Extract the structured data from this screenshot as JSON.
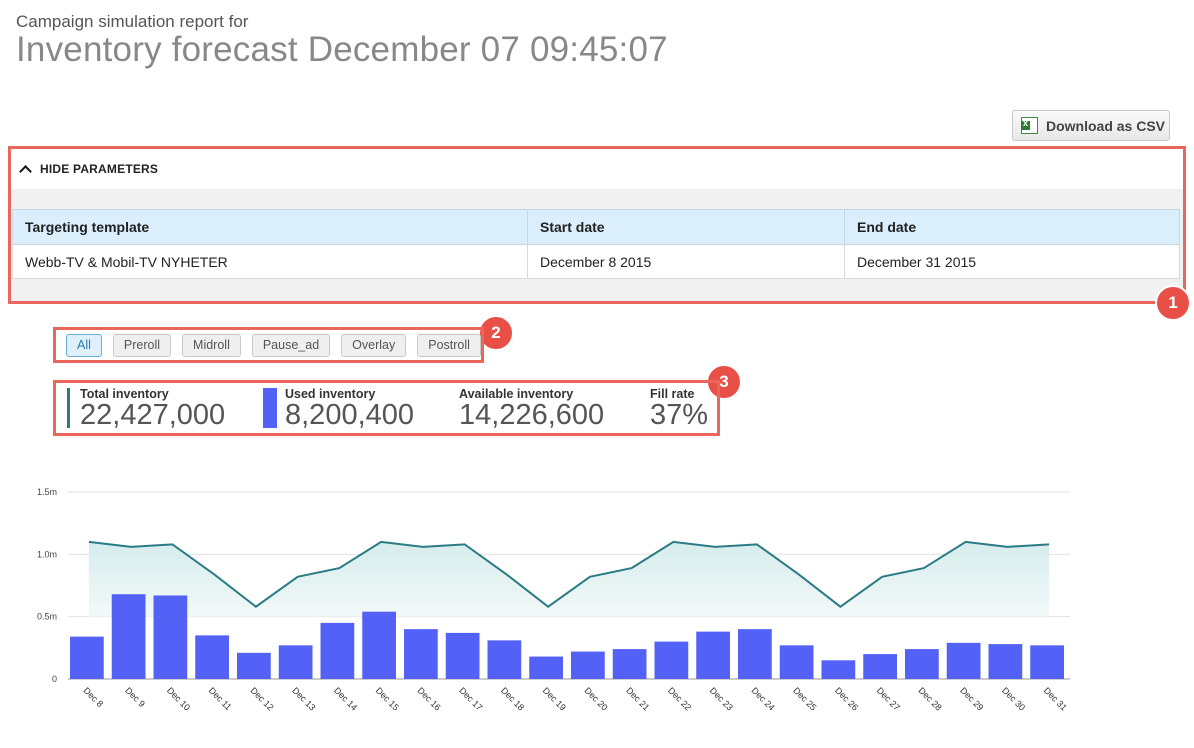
{
  "header": {
    "subtitle": "Campaign simulation report for",
    "title": "Inventory forecast December 07 09:45:07"
  },
  "toolbar": {
    "download_label": "Download as CSV",
    "download_icon": "excel-file-icon"
  },
  "parameters": {
    "toggle_label": "HIDE PARAMETERS",
    "columns": [
      "Targeting template",
      "Start date",
      "End date"
    ],
    "row": [
      "Webb-TV & Mobil-TV NYHETER",
      "December 8 2015",
      "December 31 2015"
    ]
  },
  "annotations": [
    "1",
    "2",
    "3"
  ],
  "filters": {
    "options": [
      "All",
      "Preroll",
      "Midroll",
      "Pause_ad",
      "Overlay",
      "Postroll"
    ],
    "selected": "All"
  },
  "stats": {
    "total_label": "Total inventory",
    "total_value": "22,427,000",
    "used_label": "Used inventory",
    "used_value": "8,200,400",
    "available_label": "Available inventory",
    "available_value": "14,226,600",
    "fill_label": "Fill rate",
    "fill_value": "37%"
  },
  "colors": {
    "accent_border": "#e8665a",
    "badge": "#e84f47",
    "bar": "#5461f7",
    "line": "#2a7b86",
    "area": "#e4f1f1"
  },
  "chart_data": {
    "type": "bar",
    "categories": [
      "Dec 8",
      "Dec 9",
      "Dec 10",
      "Dec 11",
      "Dec 12",
      "Dec 13",
      "Dec 14",
      "Dec 15",
      "Dec 16",
      "Dec 17",
      "Dec 18",
      "Dec 19",
      "Dec 20",
      "Dec 21",
      "Dec 22",
      "Dec 23",
      "Dec 24",
      "Dec 25",
      "Dec 26",
      "Dec 27",
      "Dec 28",
      "Dec 29",
      "Dec 30",
      "Dec 31"
    ],
    "series": [
      {
        "values": [
          0.34,
          0.68,
          0.67,
          0.35,
          0.21,
          0.27,
          0.45,
          0.54,
          0.4,
          0.37,
          0.31,
          0.18,
          0.22,
          0.24,
          0.3,
          0.38,
          0.4,
          0.27,
          0.15,
          0.2,
          0.24,
          0.29,
          0.28,
          0.27
        ]
      },
      {
        "values": [
          1.1,
          1.06,
          1.08,
          0.84,
          0.58,
          0.82,
          0.89,
          1.1,
          1.06,
          1.08,
          0.84,
          0.58,
          0.82,
          0.89,
          1.1,
          1.06,
          1.08,
          0.84,
          0.58,
          0.82,
          0.89,
          1.1,
          1.06,
          1.08
        ]
      }
    ],
    "yticks": [
      "0",
      "0.5m",
      "1.0m",
      "1.5m"
    ],
    "ylim": [
      0,
      1.5
    ],
    "grid": true
  }
}
